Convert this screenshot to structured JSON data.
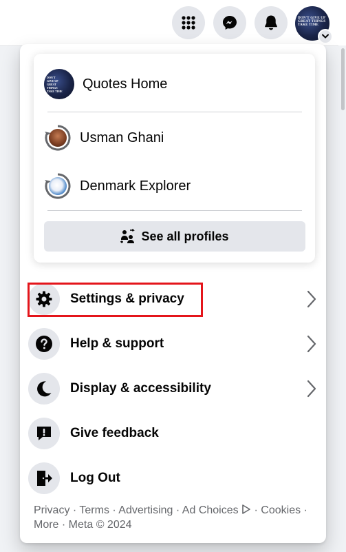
{
  "topbar": {
    "icons": [
      "menu-grid-icon",
      "messenger-icon",
      "bell-icon"
    ],
    "avatar_text": "DON'T GIVE UP GREAT THINGS TAKE TIME"
  },
  "profiles": [
    {
      "name": "Quotes Home",
      "avatar": "quotes-avatar"
    },
    {
      "name": "Usman Ghani",
      "avatar": "switch-avatar"
    },
    {
      "name": "Denmark Explorer",
      "avatar": "switch-avatar"
    }
  ],
  "see_all_label": "See all profiles",
  "menu": [
    {
      "label": "Settings & privacy",
      "icon": "gear-icon",
      "chevron": true
    },
    {
      "label": "Help & support",
      "icon": "question-icon",
      "chevron": true
    },
    {
      "label": "Display & accessibility",
      "icon": "moon-icon",
      "chevron": true
    },
    {
      "label": "Give feedback",
      "icon": "feedback-icon",
      "chevron": false
    },
    {
      "label": "Log Out",
      "icon": "logout-icon",
      "chevron": false
    }
  ],
  "footer": {
    "links": [
      "Privacy",
      "Terms",
      "Advertising",
      "Ad Choices",
      "Cookies",
      "More"
    ],
    "copyright": "Meta © 2024"
  },
  "colors": {
    "highlight": "#e4151b",
    "icon_bg": "#e4e6eb",
    "page_bg": "#f0f2f5"
  }
}
